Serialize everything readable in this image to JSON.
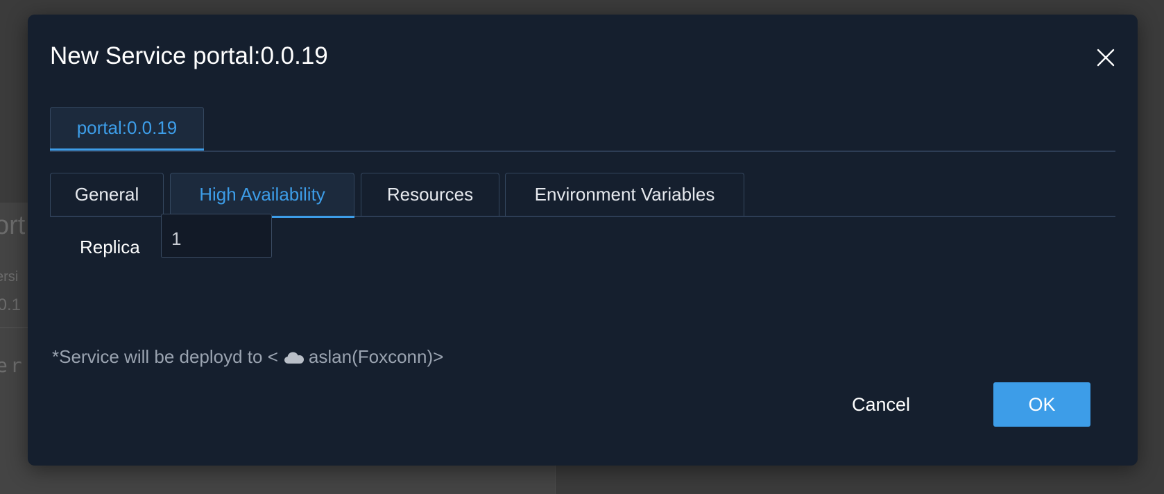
{
  "background": {
    "title_fragment": "ort",
    "subtitle_fragment": "ersi",
    "version_fragment": ".0.1",
    "mono_fragment": "er"
  },
  "modal": {
    "title": "New Service portal:0.0.19",
    "close_icon": "close-icon"
  },
  "service_tabs": [
    {
      "label": "portal:0.0.19",
      "active": true
    }
  ],
  "config_tabs": [
    {
      "label": "General",
      "active": false
    },
    {
      "label": "High Availability",
      "active": true
    },
    {
      "label": "Resources",
      "active": false
    },
    {
      "label": "Environment Variables",
      "active": false
    }
  ],
  "form": {
    "replica_label": "Replica",
    "replica_value": "1"
  },
  "deploy_note": {
    "prefix": "*Service will be deployd to <",
    "icon": "cloud-icon",
    "target": "aslan(Foxconn)>"
  },
  "footer": {
    "cancel_label": "Cancel",
    "ok_label": "OK"
  },
  "colors": {
    "modal_bg": "#151f2e",
    "accent": "#3d9de8",
    "overlay": "#3b3b3b"
  }
}
